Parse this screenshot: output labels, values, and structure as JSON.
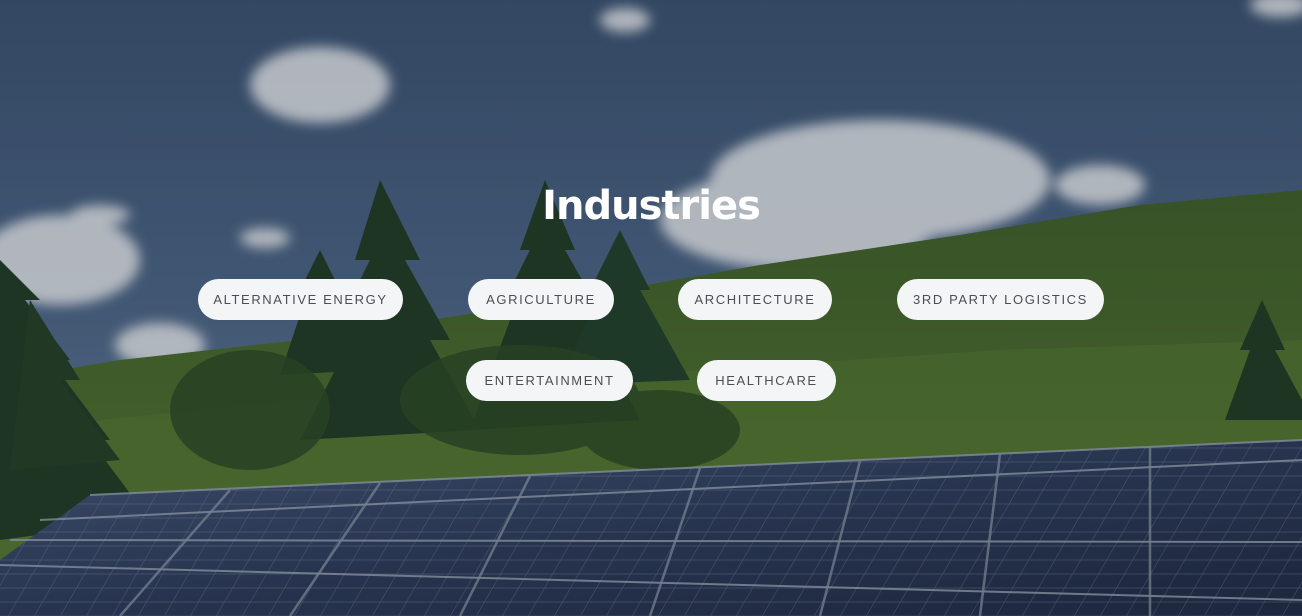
{
  "section": {
    "title": "Industries"
  },
  "industries": [
    {
      "label": "ALTERNATIVE ENERGY"
    },
    {
      "label": "AGRICULTURE"
    },
    {
      "label": "ARCHITECTURE"
    },
    {
      "label": "3RD PARTY LOGISTICS"
    },
    {
      "label": "ENTERTAINMENT"
    },
    {
      "label": "HEALTHCARE"
    }
  ],
  "colors": {
    "sky": "#3e5674",
    "hill": "#4a6a2c",
    "pill_bg": "#f4f5f7",
    "pill_text": "#4a4f55",
    "title_text": "#ffffff"
  }
}
